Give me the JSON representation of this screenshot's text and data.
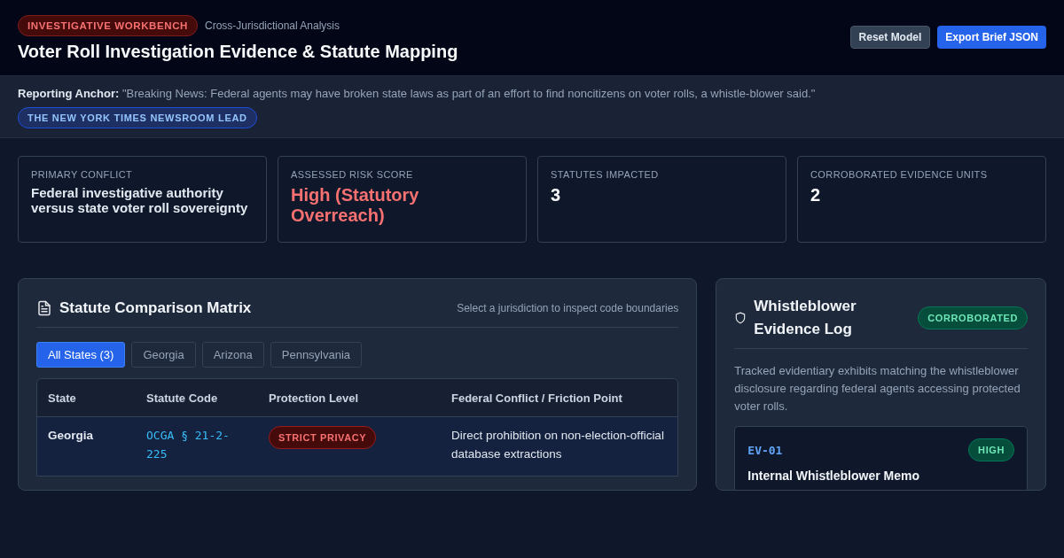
{
  "header": {
    "badge": "INVESTIGATIVE WORKBENCH",
    "subtitle": "Cross-Jurisdictional Analysis",
    "title": "Voter Roll Investigation Evidence & Statute Mapping",
    "buttons": [
      {
        "label": "Reset Model",
        "kind": "secondary"
      },
      {
        "label": "Export Brief JSON",
        "kind": "primary"
      }
    ]
  },
  "anchor": {
    "label": "Reporting Anchor:",
    "quote": "\"Breaking News: Federal agents may have broken state laws as part of an effort to find noncitizens on voter rolls, a whistle-blower said.\"",
    "source": "THE NEW YORK TIMES NEWSROOM LEAD"
  },
  "stats": [
    {
      "label": "PRIMARY CONFLICT",
      "value": "Federal investigative authority versus state voter roll sovereignty",
      "kind": "text"
    },
    {
      "label": "ASSESSED RISK SCORE",
      "value": "High (Statutory Overreach)",
      "kind": "alert"
    },
    {
      "label": "STATUTES IMPACTED",
      "value": "3",
      "kind": "number"
    },
    {
      "label": "CORROBORATED EVIDENCE UNITS",
      "value": "2",
      "kind": "number"
    }
  ],
  "matrix": {
    "title": "Statute Comparison Matrix",
    "hint": "Select a jurisdiction to inspect code boundaries",
    "filters": [
      {
        "label": "All States (3)",
        "selected": true
      },
      {
        "label": "Georgia",
        "selected": false
      },
      {
        "label": "Arizona",
        "selected": false
      },
      {
        "label": "Pennsylvania",
        "selected": false
      }
    ],
    "columns": [
      "State",
      "Statute Code",
      "Protection Level",
      "Federal Conflict / Friction Point"
    ],
    "rows": [
      {
        "state": "Georgia",
        "code": "OCGA § 21-2-225",
        "protection": "STRICT PRIVACY",
        "kind": "strict",
        "conflict": "Direct prohibition on non-election-official database extractions",
        "selected": true
      }
    ]
  },
  "evidence": {
    "title": "Whistleblower Evidence Log",
    "status": "CORROBORATED",
    "description": "Tracked evidentiary exhibits matching the whistleblower disclosure regarding federal agents accessing protected voter rolls.",
    "items": [
      {
        "id": "EV-01",
        "level": "HIGH",
        "title": "Internal Whistleblower Memo"
      }
    ]
  }
}
